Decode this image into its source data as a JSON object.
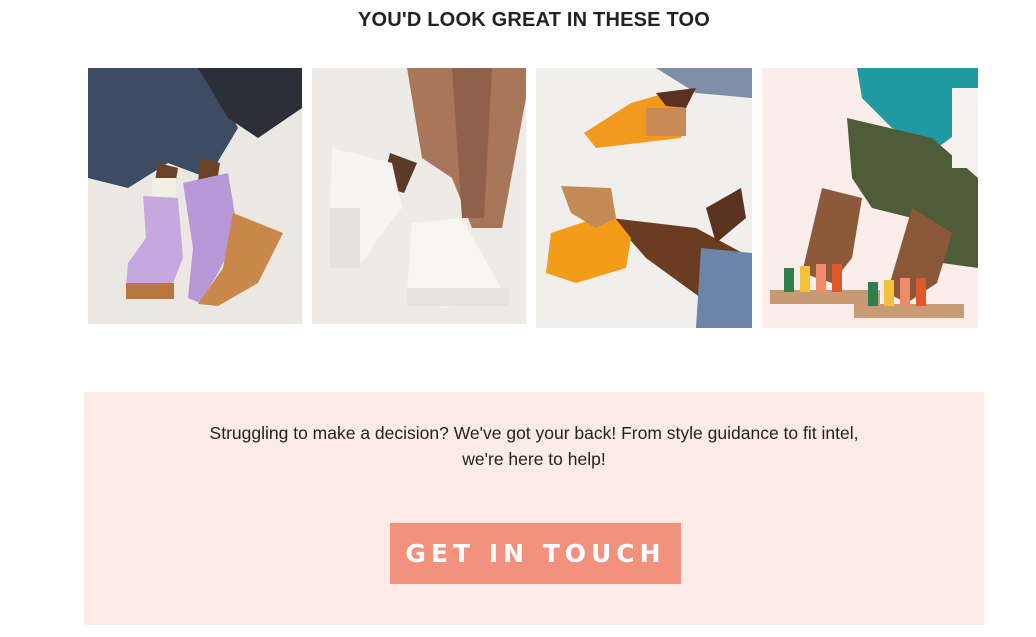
{
  "section": {
    "heading": "YOU'D LOOK GREAT IN THESE TOO"
  },
  "products": [
    {
      "image_name": "lavender-suede-platform-boots-photo"
    },
    {
      "image_name": "white-lace-up-creeper-shoes-photo"
    },
    {
      "image_name": "orange-suede-clog-mules-photo"
    },
    {
      "image_name": "multicolor-strappy-sandals-photo"
    }
  ],
  "help": {
    "line_1": "Struggling to make a decision? We've got your back! From style guidance to fit intel,",
    "line_2": "we're here to help!",
    "button_label": "GET IN TOUCH"
  },
  "colors": {
    "panel_background": "#fdebe8",
    "button_background": "#f2917d",
    "button_text": "#ffffff",
    "heading_text": "#222222"
  }
}
